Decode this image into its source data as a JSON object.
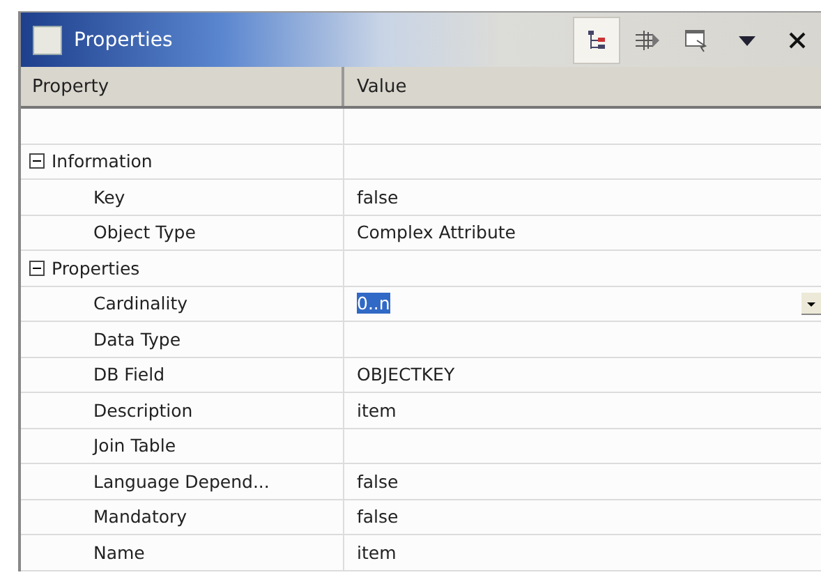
{
  "window": {
    "title": "Properties"
  },
  "toolbar": [
    {
      "kind": "tree",
      "selected": true
    },
    {
      "kind": "filter",
      "selected": false
    },
    {
      "kind": "restore",
      "selected": false
    },
    {
      "kind": "menu",
      "selected": false
    },
    {
      "kind": "close",
      "selected": false
    }
  ],
  "table": {
    "columns": [
      "Property",
      "Value"
    ],
    "groups": [
      {
        "label": "Information",
        "expanded": true,
        "children": [
          {
            "property": "Key",
            "value": "false",
            "editing": false
          },
          {
            "property": "Object Type",
            "value": "Complex Attribute",
            "editing": false
          }
        ]
      },
      {
        "label": "Properties",
        "expanded": true,
        "children": [
          {
            "property": "Cardinality",
            "value": "0..n",
            "editing": true
          },
          {
            "property": "Data Type",
            "editing": false
          },
          {
            "property": "DB Field",
            "value": "OBJECTKEY",
            "editing": false
          },
          {
            "property": "Description",
            "value": "item",
            "editing": false
          },
          {
            "property": "Join Table",
            "editing": false
          },
          {
            "property": "Language Depend...",
            "value": "false",
            "editing": false
          },
          {
            "property": "Mandatory",
            "value": "false",
            "editing": false
          },
          {
            "property": "Name",
            "value": "item",
            "editing": false
          }
        ]
      }
    ]
  }
}
